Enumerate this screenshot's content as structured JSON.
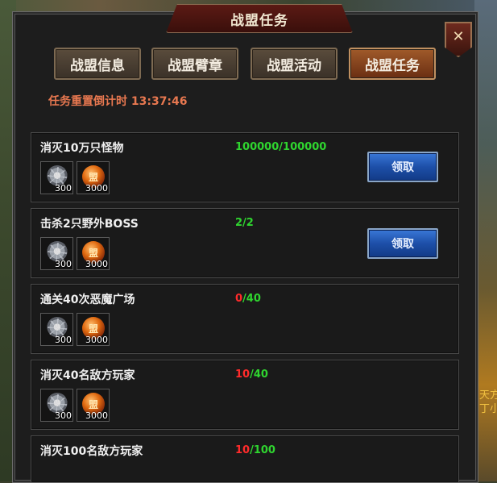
{
  "window": {
    "title": "战盟任务",
    "close_glyph": "✕"
  },
  "tabs": [
    {
      "label": "战盟信息",
      "active": false
    },
    {
      "label": "战盟臂章",
      "active": false
    },
    {
      "label": "战盟活动",
      "active": false
    },
    {
      "label": "战盟任务",
      "active": true
    }
  ],
  "reset_timer": "任务重置倒计时 13:37:46",
  "tasks": [
    {
      "name": "消灭10万只怪物",
      "progress_current": "100000",
      "progress_sep": "/",
      "progress_total": "100000",
      "completed": true,
      "rewards": [
        {
          "icon": "silver-medal-icon",
          "qty": "300"
        },
        {
          "icon": "alliance-orb-icon",
          "glyph": "盟",
          "qty": "3000"
        }
      ],
      "claim_label": "领取"
    },
    {
      "name": "击杀2只野外BOSS",
      "progress_current": "2",
      "progress_sep": "/",
      "progress_total": "2",
      "completed": true,
      "rewards": [
        {
          "icon": "silver-medal-icon",
          "qty": "300"
        },
        {
          "icon": "alliance-orb-icon",
          "glyph": "盟",
          "qty": "3000"
        }
      ],
      "claim_label": "领取"
    },
    {
      "name": "通关40次恶魔广场",
      "progress_current": "0",
      "progress_sep": "/",
      "progress_total": "40",
      "completed": false,
      "rewards": [
        {
          "icon": "silver-medal-icon",
          "qty": "300"
        },
        {
          "icon": "alliance-orb-icon",
          "glyph": "盟",
          "qty": "3000"
        }
      ]
    },
    {
      "name": "消灭40名敌方玩家",
      "progress_current": "10",
      "progress_sep": "/",
      "progress_total": "40",
      "completed": false,
      "rewards": [
        {
          "icon": "silver-medal-icon",
          "qty": "300"
        },
        {
          "icon": "alliance-orb-icon",
          "glyph": "盟",
          "qty": "3000"
        }
      ]
    },
    {
      "name": "消灭100名敌方玩家",
      "progress_current": "10",
      "progress_sep": "/",
      "progress_total": "100",
      "completed": false
    }
  ],
  "background": {
    "side_text": "天方\n丁小"
  },
  "colors": {
    "progress_done": "#2fd52f",
    "progress_incomplete": "#ff2b2b",
    "timer": "#e87850",
    "active_tab": "#a05a2a",
    "claim_button": "#1d4fa8"
  }
}
